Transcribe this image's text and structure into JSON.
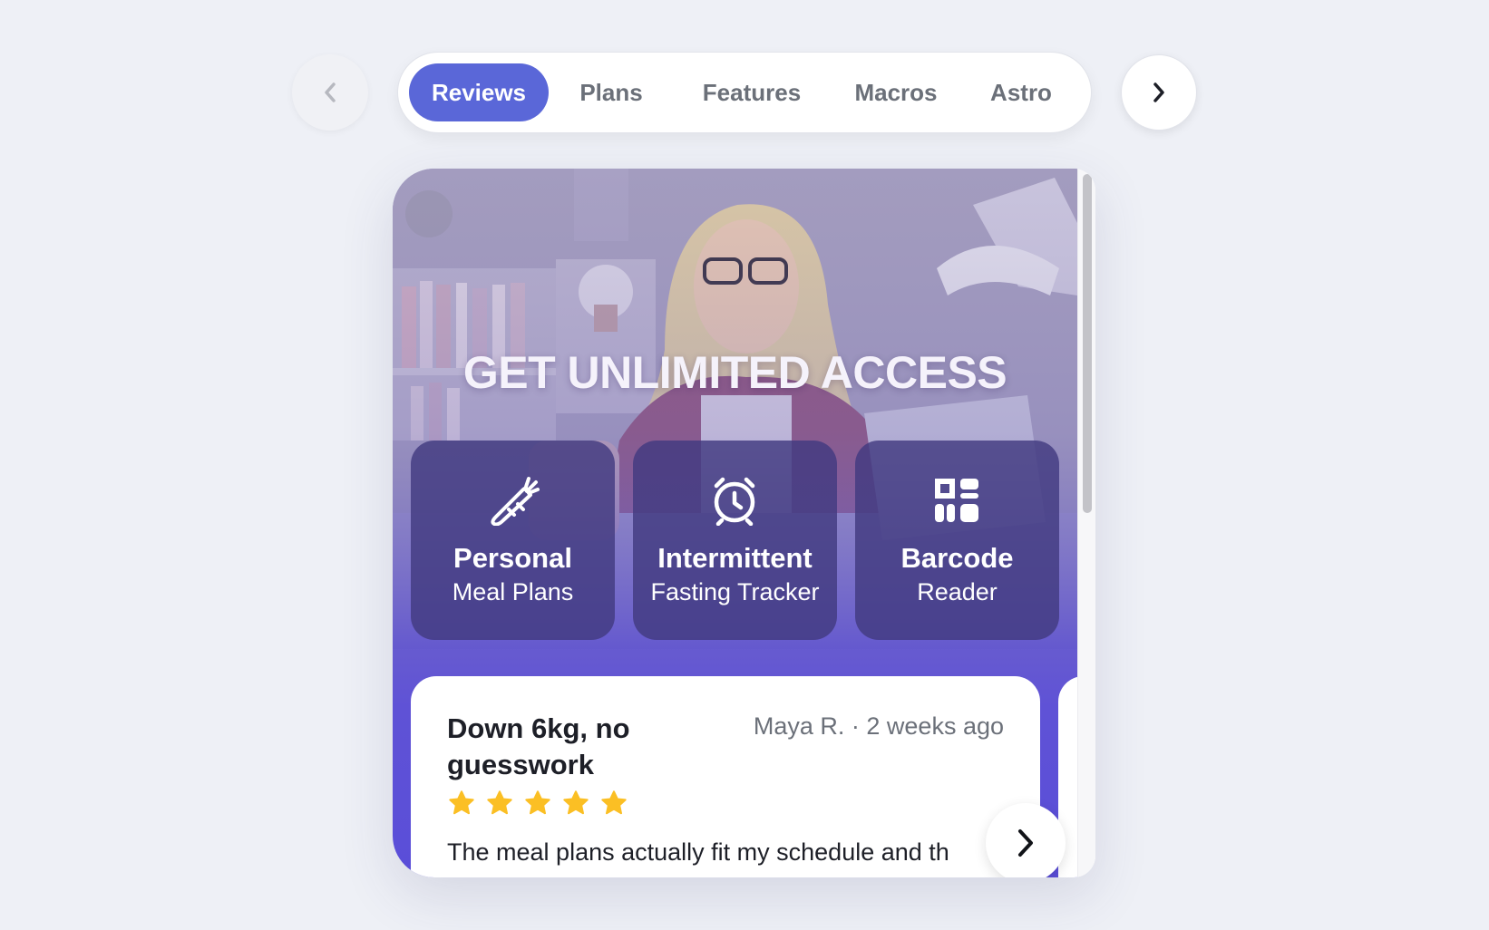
{
  "nav": {
    "prev_icon": "chevron-left-icon",
    "next_icon": "chevron-right-icon",
    "tabs": [
      {
        "label": "Reviews",
        "active": true
      },
      {
        "label": "Plans",
        "active": false
      },
      {
        "label": "Features",
        "active": false
      },
      {
        "label": "Macros",
        "active": false
      },
      {
        "label": "Astro",
        "active": false
      }
    ],
    "active_color": "#5a67d8"
  },
  "hero": {
    "title": "GET UNLIMITED ACCESS",
    "image": "woman-with-glasses-at-desk-photo"
  },
  "features": [
    {
      "icon": "carrot-icon",
      "title": "Personal",
      "subtitle": "Meal Plans"
    },
    {
      "icon": "alarm-clock-icon",
      "title": "Intermittent",
      "subtitle": "Fasting Tracker"
    },
    {
      "icon": "barcode-qr-icon",
      "title": "Barcode",
      "subtitle": "Reader"
    }
  ],
  "review": {
    "title": "Down 6kg, no guesswork",
    "author_meta": "Maya R. · 2 weeks ago",
    "rating": 5,
    "body": "The meal plans actually fit my schedule and th",
    "star_color": "#fbbf24",
    "next_icon": "chevron-right-icon"
  }
}
